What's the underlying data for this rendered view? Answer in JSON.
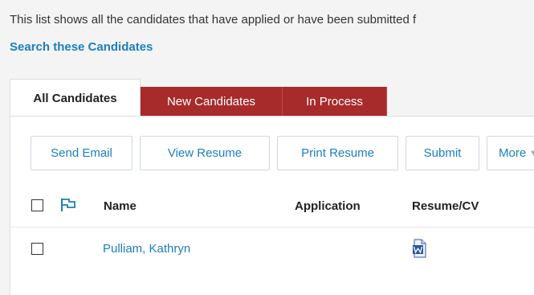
{
  "intro_text": "This list shows all the candidates that have applied or have been submitted f",
  "search_link": "Search these Candidates",
  "tabs": [
    {
      "label": "All Candidates",
      "active": true
    },
    {
      "label": "New Candidates",
      "active": false
    },
    {
      "label": "In Process",
      "active": false
    }
  ],
  "toolbar": {
    "send_email": "Send Email",
    "view_resume": "View Resume",
    "print_resume": "Print Resume",
    "submit": "Submit",
    "more": "More"
  },
  "table": {
    "headers": {
      "name": "Name",
      "application": "Application",
      "resume": "Resume/CV"
    },
    "rows": [
      {
        "name": "Pulliam, Kathryn",
        "resume_icon": "word-document-icon"
      }
    ]
  },
  "colors": {
    "accent": "#1a7fc1",
    "tab_red": "#a72b2b"
  }
}
